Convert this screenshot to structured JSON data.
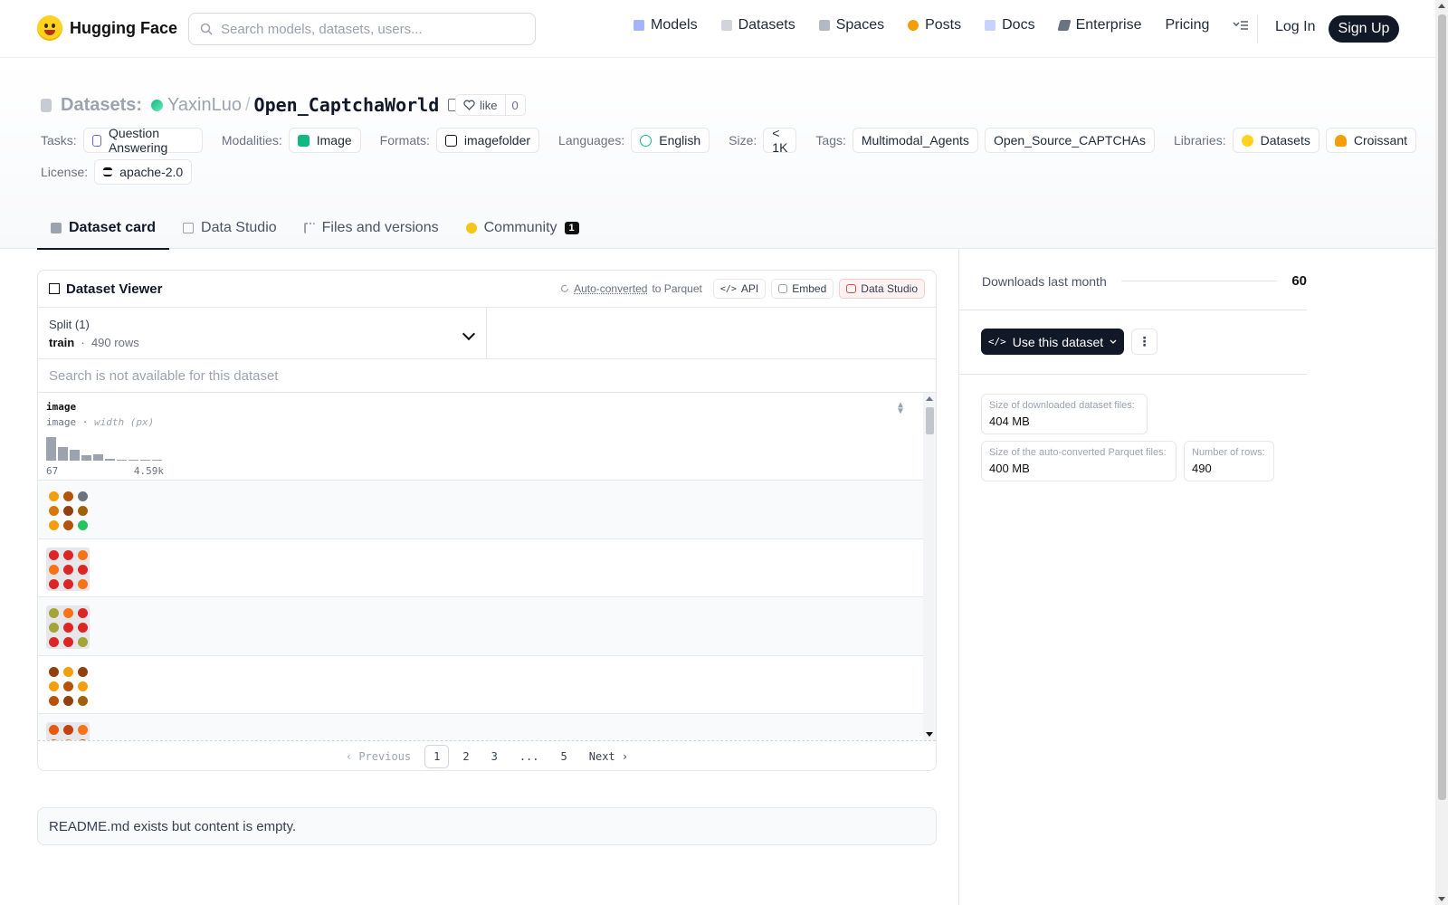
{
  "nav": {
    "brand": "Hugging Face",
    "search_placeholder": "Search models, datasets, users...",
    "links": [
      {
        "label": "Models",
        "icon": "models-icon",
        "color": "#818cf8"
      },
      {
        "label": "Datasets",
        "icon": "datasets-icon",
        "color": "#c7ccd4"
      },
      {
        "label": "Spaces",
        "icon": "spaces-icon",
        "color": "#9ca3af"
      },
      {
        "label": "Posts",
        "icon": "posts-icon",
        "color": "#f59e0b"
      },
      {
        "label": "Docs",
        "icon": "docs-icon",
        "color": "#a5b4fc"
      },
      {
        "label": "Enterprise",
        "icon": "enterprise-icon",
        "color": "#6b7280"
      },
      {
        "label": "Pricing"
      }
    ],
    "login": "Log In",
    "signup": "Sign Up"
  },
  "header": {
    "section": "Datasets:",
    "org": "YaxinLuo",
    "repo": "Open_CaptchaWorld",
    "like_label": "like",
    "like_count": "0"
  },
  "tags": {
    "tasks_label": "Tasks:",
    "task": "Question Answering",
    "modalities_label": "Modalities:",
    "modality": "Image",
    "formats_label": "Formats:",
    "format": "imagefolder",
    "languages_label": "Languages:",
    "language": "English",
    "size_label": "Size:",
    "size": "< 1K",
    "tags_label": "Tags:",
    "tag1": "Multimodal_Agents",
    "tag2": "Open_Source_CAPTCHAs",
    "libraries_label": "Libraries:",
    "lib1": "Datasets",
    "lib2": "Croissant",
    "license_label": "License:",
    "license": "apache-2.0"
  },
  "tabs": {
    "card": "Dataset card",
    "studio": "Data Studio",
    "files": "Files and versions",
    "community": "Community",
    "community_badge": "1"
  },
  "viewer": {
    "title": "Dataset Viewer",
    "auto_converted": "Auto-converted",
    "to_parquet": "to Parquet",
    "api": "API",
    "embed": "Embed",
    "studio": "Data Studio",
    "split_title": "Split (1)",
    "split_name": "train",
    "split_rows": "490 rows",
    "search_na": "Search is not available for this dataset",
    "col_name": "image",
    "col_type": "image",
    "col_stat": "width (px)",
    "hist_min": "67",
    "hist_max": "4.59k",
    "hist_counts": [
      26,
      15,
      12,
      6,
      7,
      2,
      1,
      0,
      1,
      1
    ],
    "pager": {
      "prev": "Previous",
      "p1": "1",
      "p2": "2",
      "p3": "3",
      "ellipsis": "...",
      "p5": "5",
      "next": "Next"
    }
  },
  "readme_text": "README.md exists but content is empty.",
  "sidebar": {
    "downloads_label": "Downloads last month",
    "downloads": "60",
    "use_button": "Use this dataset",
    "dl_size_label": "Size of downloaded dataset files:",
    "dl_size": "404 MB",
    "parquet_size_label": "Size of the auto-converted Parquet files:",
    "parquet_size": "400 MB",
    "rows_label": "Number of rows:",
    "rows": "490"
  },
  "colors": {
    "accent": "#111827",
    "studio_red": "#ef4444",
    "hf_yellow": "#ffd21e"
  }
}
